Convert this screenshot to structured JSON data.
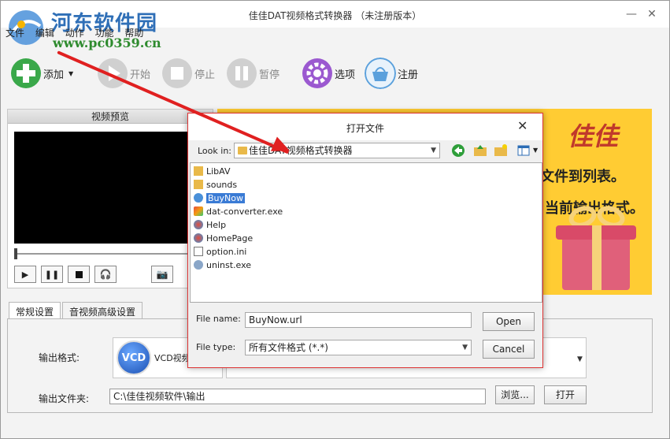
{
  "window": {
    "title": "佳佳DAT视频格式转换器 （未注册版本）",
    "minimize_glyph": "—",
    "close_glyph": "✕"
  },
  "watermark": {
    "name": "河东软件园",
    "url": "www.pc0359.cn"
  },
  "menu": [
    "文件",
    "编辑",
    "动作",
    "功能",
    "帮助"
  ],
  "toolbar": {
    "add": "添加",
    "start": "开始",
    "stop": "停止",
    "pause": "暂停",
    "options": "选项",
    "register": "注册"
  },
  "preview": {
    "header": "视频预览"
  },
  "banner": {
    "title": "佳佳",
    "line1": "文件到列表。",
    "line2": "当前输出格式。"
  },
  "tabs": [
    "常规设置",
    "音视频高级设置"
  ],
  "settings": {
    "output_format_label": "输出格式:",
    "output_format_badge": "VCD",
    "output_format_value": "VCD视频",
    "output_folder_label": "输出文件夹:",
    "output_folder_value": "C:\\佳佳视频软件\\输出",
    "browse_button": "浏览...",
    "open_button": "打开"
  },
  "dialog": {
    "title": "打开文件",
    "look_in_label": "Look in:",
    "look_in_value": "佳佳DAT视频格式转换器",
    "files": [
      {
        "name": "LibAV",
        "type": "folder"
      },
      {
        "name": "sounds",
        "type": "folder"
      },
      {
        "name": "BuyNow",
        "type": "url",
        "selected": true
      },
      {
        "name": "dat-converter.exe",
        "type": "exe"
      },
      {
        "name": "Help",
        "type": "url"
      },
      {
        "name": "HomePage",
        "type": "url"
      },
      {
        "name": "option.ini",
        "type": "ini"
      },
      {
        "name": "uninst.exe",
        "type": "exe"
      }
    ],
    "file_name_label": "File name:",
    "file_name_value": "BuyNow.url",
    "file_type_label": "File type:",
    "file_type_value": "所有文件格式 (*.*)",
    "open_button": "Open",
    "cancel_button": "Cancel"
  },
  "colors": {
    "accent_red": "#e02020",
    "banner_yellow": "#ffcc33",
    "selection_blue": "#3a7bd5"
  }
}
